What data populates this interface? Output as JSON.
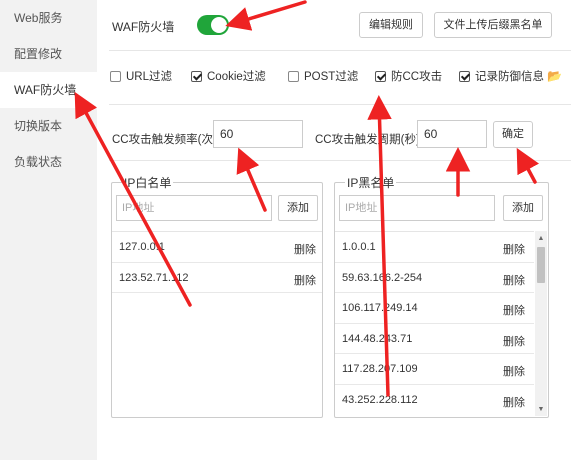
{
  "sidebar": {
    "items": [
      {
        "label": "Web服务"
      },
      {
        "label": "配置修改"
      },
      {
        "label": "WAF防火墙"
      },
      {
        "label": "切换版本"
      },
      {
        "label": "负载状态"
      }
    ]
  },
  "waf": {
    "label": "WAF防火墙",
    "enabled": true,
    "edit_rules": "编辑规则",
    "upload_blacklist": "文件上传后缀黑名单"
  },
  "options": [
    {
      "label": "URL过滤",
      "checked": false
    },
    {
      "label": "Cookie过滤",
      "checked": true
    },
    {
      "label": "POST过滤",
      "checked": false
    },
    {
      "label": "防CC攻击",
      "checked": true
    },
    {
      "label": "记录防御信息",
      "checked": true
    }
  ],
  "cc": {
    "freq_label": "CC攻击触发频率(次)",
    "freq_value": "60",
    "cycle_label": "CC攻击触发周期(秒)",
    "cycle_value": "60",
    "confirm": "确定"
  },
  "whitelist": {
    "title": "IP白名单",
    "placeholder": "IP地址",
    "add": "添加",
    "delete_label": "删除",
    "items": [
      "127.0.0.1",
      "123.52.71.112"
    ]
  },
  "blacklist": {
    "title": "IP黑名单",
    "placeholder": "IP地址",
    "add": "添加",
    "delete_label": "删除",
    "items": [
      "1.0.0.1",
      "59.63.166.2-254",
      "106.117.249.14",
      "144.48.243.71",
      "117.28.207.109",
      "43.252.228.112"
    ]
  },
  "colors": {
    "toggle_on": "#20a53a",
    "annotation_arrow": "#ee2222",
    "sidebar_bg": "#f2f2f2"
  }
}
